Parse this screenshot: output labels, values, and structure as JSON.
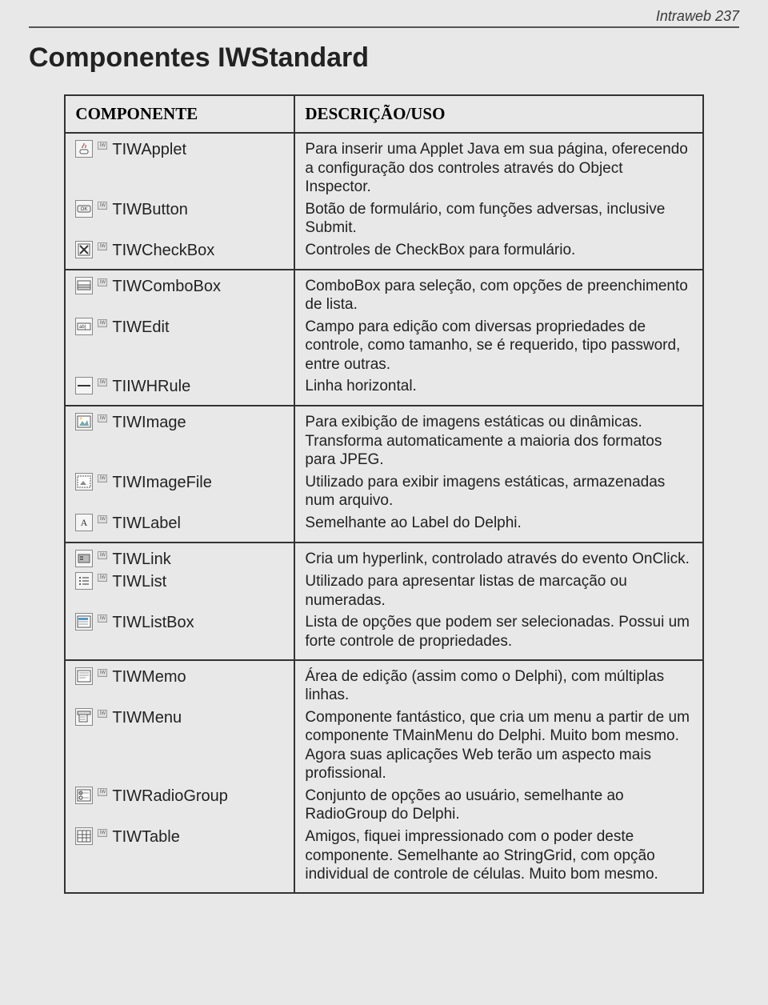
{
  "running_head": "Intraweb 237",
  "title": "Componentes IWStandard",
  "headers": {
    "col1": "COMPONENTE",
    "col2": "DESCRIÇÃO/USO"
  },
  "groups": [
    {
      "rows": [
        {
          "icon": "applet",
          "name": "TIWApplet",
          "desc": "Para inserir uma Applet Java em sua página, oferecendo a configuração dos controles através do Object Inspector."
        },
        {
          "icon": "button",
          "name": "TIWButton",
          "desc": "Botão de formulário, com funções adversas, inclusive Submit."
        },
        {
          "icon": "checkbox",
          "name": "TIWCheckBox",
          "desc": "Controles de CheckBox para formulário."
        }
      ]
    },
    {
      "rows": [
        {
          "icon": "combo",
          "name": "TIWComboBox",
          "desc": "ComboBox para seleção, com opções de preenchimento de lista."
        },
        {
          "icon": "edit",
          "name": "TIWEdit",
          "desc": "Campo para edição com diversas propriedades de controle, como tamanho, se é requerido, tipo password, entre outras."
        },
        {
          "icon": "hrule",
          "name": "TIIWHRule",
          "desc": "Linha horizontal."
        }
      ]
    },
    {
      "rows": [
        {
          "icon": "image",
          "name": "TIWImage",
          "desc": "Para exibição de imagens estáticas ou dinâmicas. Transforma automaticamente a maioria dos formatos para JPEG."
        },
        {
          "icon": "imagefile",
          "name": "TIWImageFile",
          "desc": "Utilizado para exibir imagens estáticas, armazenadas num arquivo."
        },
        {
          "icon": "label",
          "name": "TIWLabel",
          "desc": "Semelhante ao Label do Delphi."
        }
      ]
    },
    {
      "rows": [
        {
          "icon": "link",
          "name": "TIWLink",
          "desc": "Cria um hyperlink, controlado através do evento OnClick."
        },
        {
          "icon": "list",
          "name": "TIWList",
          "desc": "Utilizado para apresentar listas de marcação ou numeradas."
        },
        {
          "icon": "listbox",
          "name": "TIWListBox",
          "desc": "Lista de opções que podem ser selecionadas. Possui um forte controle de propriedades."
        }
      ]
    },
    {
      "rows": [
        {
          "icon": "memo",
          "name": "TIWMemo",
          "desc": "Área de edição (assim como o Delphi), com múltiplas linhas."
        },
        {
          "icon": "menu",
          "name": "TIWMenu",
          "desc": "Componente fantástico, que cria um menu a partir de um componente TMainMenu do Delphi. Muito bom mesmo. Agora suas aplicações Web terão um aspecto mais profissional."
        },
        {
          "icon": "radio",
          "name": "TIWRadioGroup",
          "desc": "Conjunto de opções ao usuário, semelhante ao RadioGroup do Delphi."
        },
        {
          "icon": "table",
          "name": "TIWTable",
          "desc": "Amigos, fiquei impressionado com o poder deste componente. Semelhante ao StringGrid, com opção individual de controle de células. Muito bom mesmo."
        }
      ]
    }
  ]
}
